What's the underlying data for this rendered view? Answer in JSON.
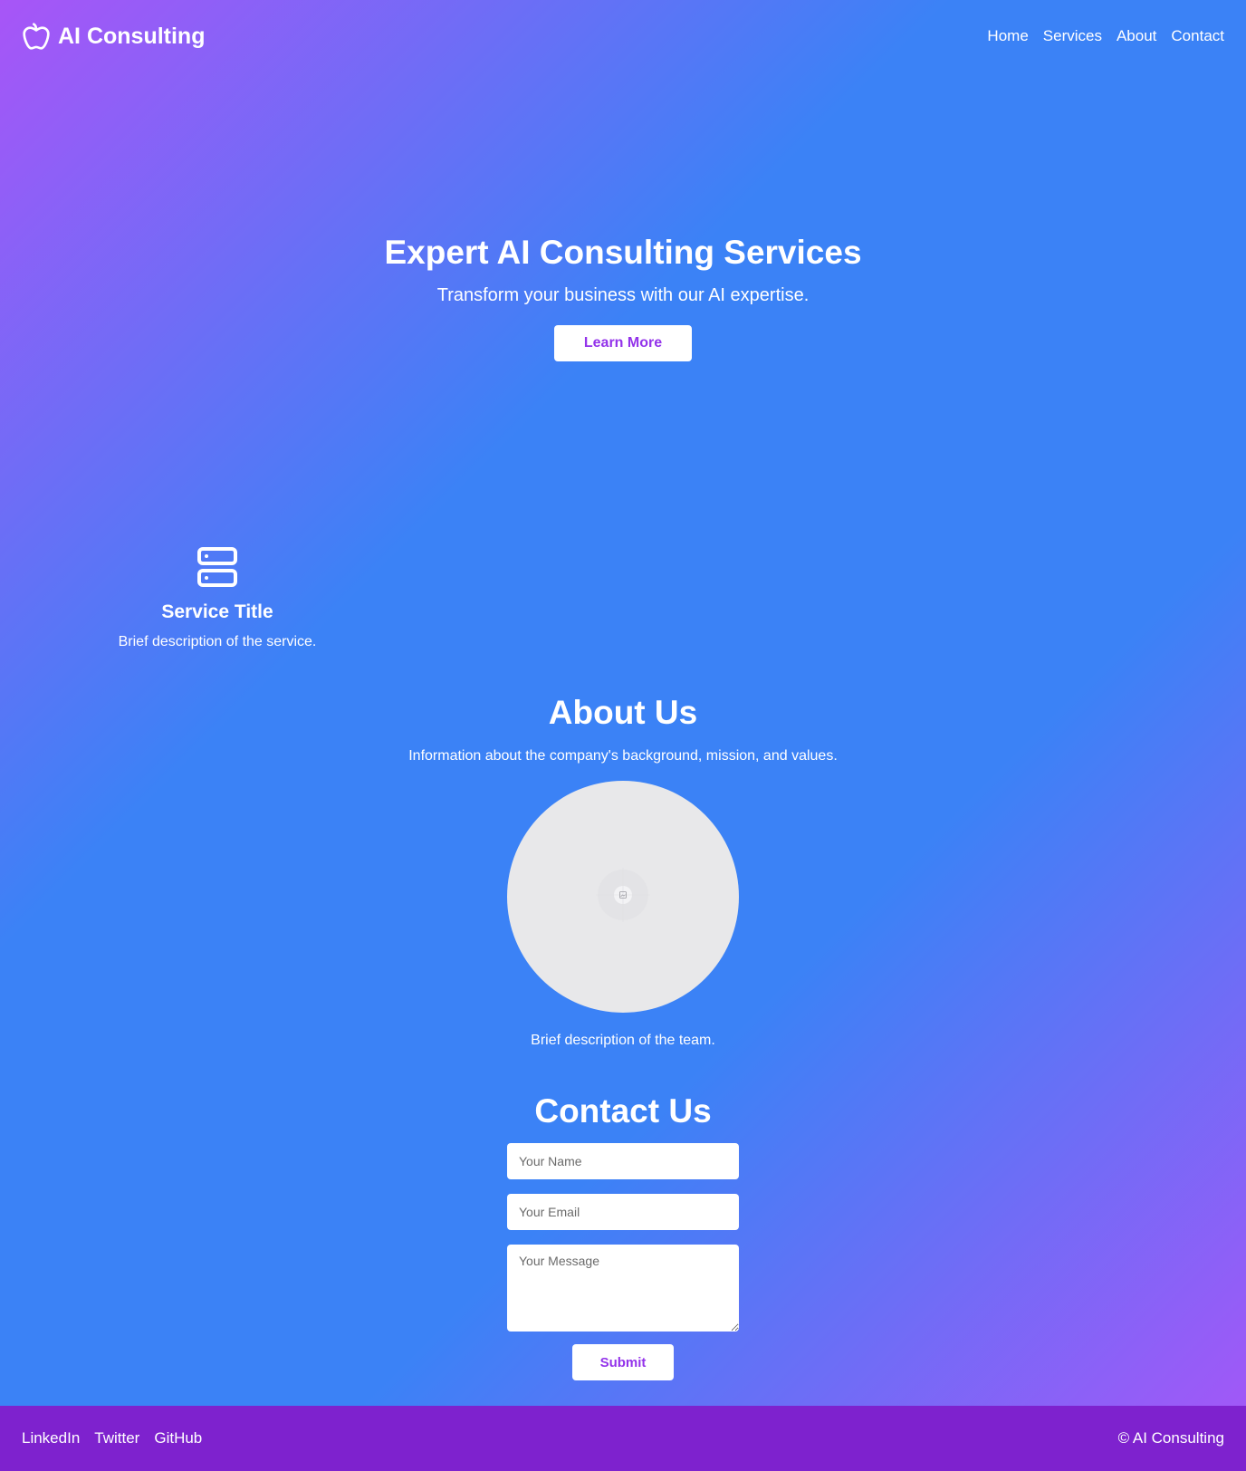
{
  "header": {
    "brand_icon": "apple-icon",
    "brand_name": "AI Consulting",
    "nav": [
      {
        "label": "Home"
      },
      {
        "label": "Services"
      },
      {
        "label": "About"
      },
      {
        "label": "Contact"
      }
    ]
  },
  "hero": {
    "title": "Expert AI Consulting Services",
    "subtitle": "Transform your business with our AI expertise.",
    "button_label": "Learn More"
  },
  "services": [
    {
      "icon": "server-icon",
      "title": "Service Title",
      "description": "Brief description of the service."
    }
  ],
  "about": {
    "title": "About Us",
    "text": "Information about the company's background, mission, and values.",
    "image_icon": "image-placeholder-icon",
    "team_description": "Brief description of the team."
  },
  "contact": {
    "title": "Contact Us",
    "name_placeholder": "Your Name",
    "email_placeholder": "Your Email",
    "message_placeholder": "Your Message",
    "submit_label": "Submit"
  },
  "footer": {
    "links": [
      {
        "label": "LinkedIn"
      },
      {
        "label": "Twitter"
      },
      {
        "label": "GitHub"
      }
    ],
    "copyright": "© AI Consulting"
  },
  "colors": {
    "gradient_purple": "#a855f7",
    "gradient_blue": "#3b82f6",
    "accent_text": "#9333ea",
    "footer_bg": "#7e22ce",
    "image_placeholder": "#e8e8ea"
  }
}
